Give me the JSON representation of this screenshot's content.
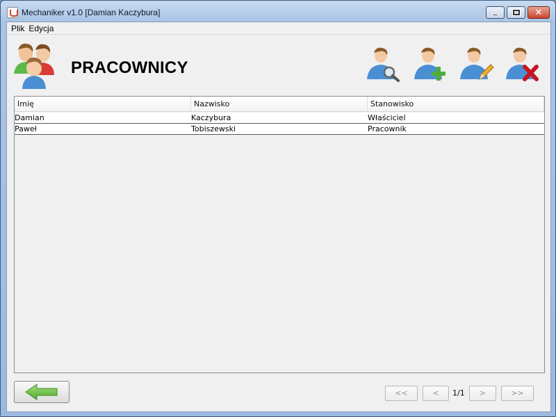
{
  "window": {
    "title": "Mechaniker v1.0 [Damian Kaczybura]"
  },
  "menu": {
    "items": [
      "Plik",
      "Edycja"
    ]
  },
  "header": {
    "title": "PRACOWNICY"
  },
  "toolbar": {
    "buttons": [
      {
        "name": "search-user-button",
        "icon": "user-search-icon"
      },
      {
        "name": "add-user-button",
        "icon": "user-add-icon"
      },
      {
        "name": "edit-user-button",
        "icon": "user-edit-icon"
      },
      {
        "name": "delete-user-button",
        "icon": "user-delete-icon"
      }
    ]
  },
  "table": {
    "columns": [
      "Imię",
      "Nazwisko",
      "Stanowisko"
    ],
    "rows": [
      [
        "Damian",
        "Kaczybura",
        "Właściciel"
      ],
      [
        "Paweł",
        "Tobiszewski",
        "Pracownik"
      ]
    ]
  },
  "pagination": {
    "first": "<<",
    "prev": "<",
    "indicator": "1/1",
    "next": ">",
    "last": ">>"
  },
  "colors": {
    "accent_green": "#6cc24a",
    "delete_red": "#c8141e",
    "person_blue": "#4a8fd4"
  }
}
